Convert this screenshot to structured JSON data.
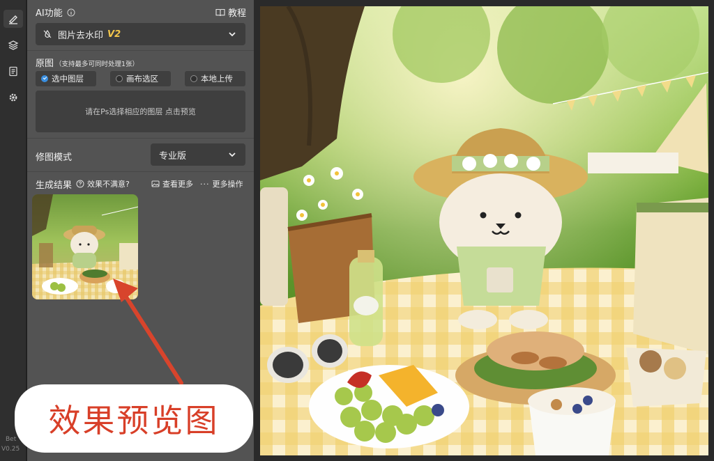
{
  "toolbar": {
    "items": [
      {
        "icon": "brush-icon",
        "active": true
      },
      {
        "icon": "layers-icon",
        "active": false
      },
      {
        "icon": "clipboard-icon",
        "active": false
      },
      {
        "icon": "gear-icon",
        "active": false
      }
    ],
    "version_beta": "Bet",
    "version_num": "V0.25"
  },
  "ai": {
    "title": "AI功能",
    "tutorial": "教程",
    "feature": "图片去水印",
    "feature_version": "V2"
  },
  "source": {
    "title": "原图",
    "hint": "（支持最多可同时处理1张）",
    "options": [
      "选中图层",
      "画布选区",
      "本地上传"
    ],
    "selected": 0,
    "placeholder": "请在Ps选择相应的图层 点击预览"
  },
  "mode": {
    "label": "修图模式",
    "value": "专业版"
  },
  "result": {
    "title": "生成结果",
    "unsatisfied": "效果不满意?",
    "view_more": "查看更多",
    "more_actions": "更多操作"
  },
  "annotation": {
    "caption": "效果预览图"
  },
  "colors": {
    "accent_yellow": "#f3c64b",
    "annotation_red": "#d83f28",
    "radio_blue": "#3a8fe0",
    "panel_bg": "#535353"
  }
}
